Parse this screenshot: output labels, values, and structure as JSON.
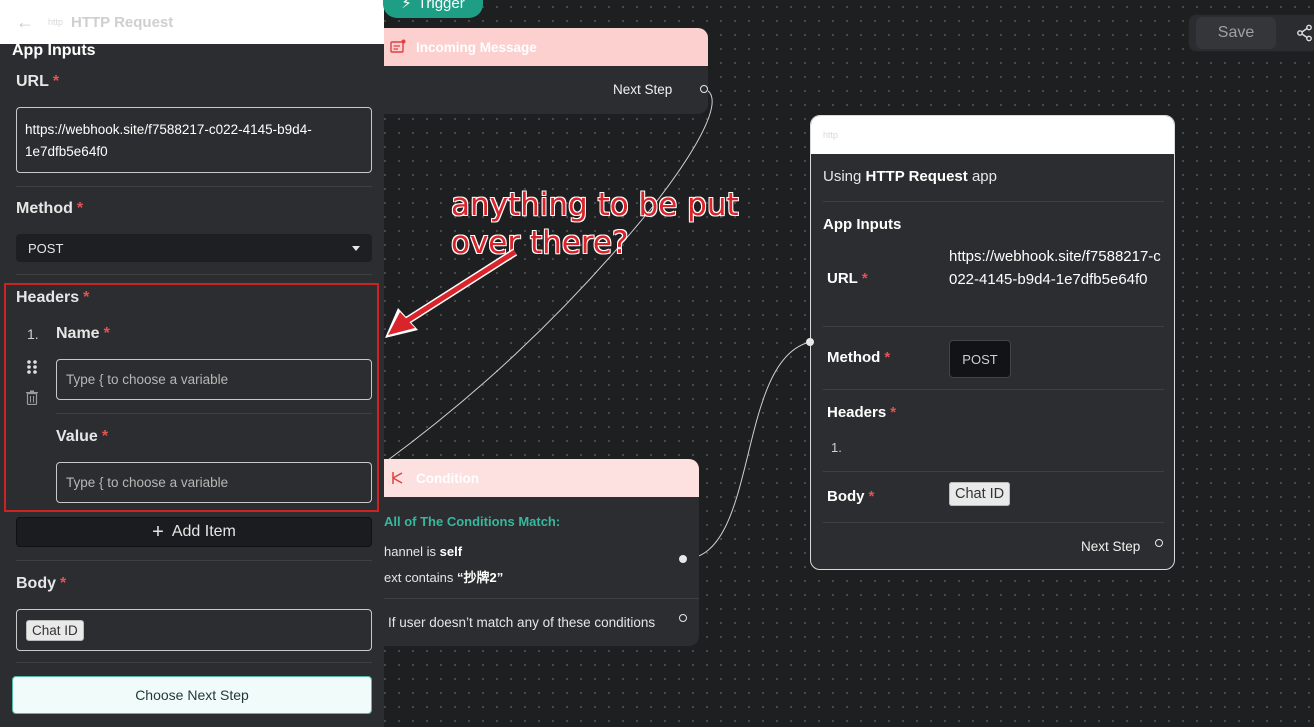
{
  "panel": {
    "header_title": "HTTP Request",
    "section_title": "App Inputs",
    "url_label": "URL",
    "url_value": "https://webhook.site/f7588217-c022-4145-b9d4-1e7dfb5e64f0",
    "method_label": "Method",
    "method_value": "POST",
    "headers_label": "Headers",
    "item_number": "1.",
    "name_label": "Name",
    "name_placeholder": "Type { to choose a variable",
    "value_label": "Value",
    "value_placeholder": "Type { to choose a variable",
    "add_item_label": "Add Item",
    "body_label": "Body",
    "body_chip": "Chat ID",
    "next_button": "Choose Next Step",
    "required_mark": "*"
  },
  "canvas": {
    "trigger_label": "Trigger",
    "incoming": {
      "title": "Incoming Message",
      "next_step": "Next Step"
    },
    "condition": {
      "title": "Condition",
      "match_title": "All of The Conditions Match:",
      "line1_prefix": "hannel ",
      "line1_mid": "is ",
      "line1_value": "self",
      "line2_prefix": "ext contains ",
      "line2_value": "“抄牌2”",
      "else_text": "If user doesn’t match any of these conditions"
    },
    "http_node": {
      "using_prefix": "Using ",
      "using_app": "HTTP Request",
      "using_suffix": " app",
      "section": "App Inputs",
      "url_label": "URL",
      "url_value": "https://webhook.site/f7588217-c022-4145-b9d4-1e7dfb5e64f0",
      "method_label": "Method",
      "method_value": "POST",
      "headers_label": "Headers",
      "headers_item": "1.",
      "body_label": "Body",
      "body_chip": "Chat ID",
      "next_step": "Next Step"
    },
    "save_label": "Save"
  },
  "annotation": {
    "line1": "anything to be put",
    "line2": "over there?",
    "color": "#d8242a"
  },
  "colors": {
    "accent": "#1f9e86",
    "required": "#e55353",
    "highlight_box": "#cc2222"
  }
}
